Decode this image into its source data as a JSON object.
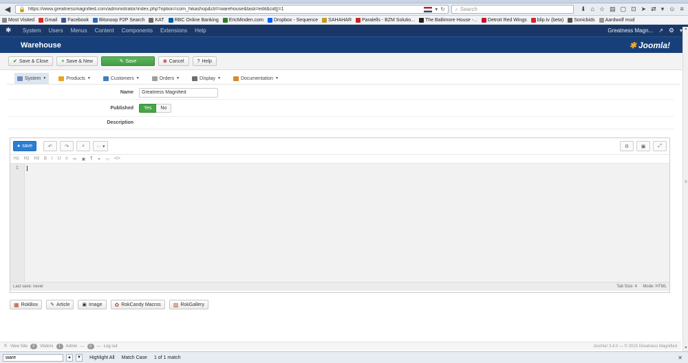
{
  "browser": {
    "url": "https://www.greatnessmagnified.com/administrator/index.php?option=com_hikashop&ctrl=warehouse&task=edit&cid[]=1",
    "search_placeholder": "Search",
    "bookmarks": [
      {
        "label": "Most Visited",
        "color": "#888888"
      },
      {
        "label": "Gmail",
        "color": "#d93025"
      },
      {
        "label": "Facebook",
        "color": "#3b5998"
      },
      {
        "label": "Bitsnoop P2P Search",
        "color": "#2b6cb0"
      },
      {
        "label": "KAT",
        "color": "#6b6b6b"
      },
      {
        "label": "RBC Online Banking",
        "color": "#005daa"
      },
      {
        "label": "EricMinden.com",
        "color": "#2d7d2d"
      },
      {
        "label": "Dropbox - Sequence",
        "color": "#0061fe"
      },
      {
        "label": "SAHAHAR",
        "color": "#c59b1a"
      },
      {
        "label": "Paralells - BZM Solutio...",
        "color": "#cc2222"
      },
      {
        "label": "The Baltimore House -...",
        "color": "#222222"
      },
      {
        "label": "Detroit Red Wings",
        "color": "#c8102e"
      },
      {
        "label": "blip.tv (beta)",
        "color": "#d9232d"
      },
      {
        "label": "Sonicbids",
        "color": "#555555"
      },
      {
        "label": "Aardwolf mud",
        "color": "#999999"
      }
    ]
  },
  "admin_bar": {
    "menu": [
      "System",
      "Users",
      "Menus",
      "Content",
      "Components",
      "Extensions",
      "Help"
    ],
    "site_name": "Greatness Magn...",
    "external_icon": "↗",
    "user_icon": "⚙"
  },
  "header": {
    "title": "Warehouse",
    "logo_text": "Joomla!"
  },
  "toolbar": {
    "save_close": "Save & Close",
    "save_new": "Save & New",
    "save": "Save",
    "cancel": "Cancel",
    "help": "Help"
  },
  "submenu": [
    {
      "label": "System",
      "color": "#6b8cbf",
      "active": true
    },
    {
      "label": "Products",
      "color": "#e8a321",
      "active": false
    },
    {
      "label": "Customers",
      "color": "#3f7fbf",
      "active": false
    },
    {
      "label": "Orders",
      "color": "#a0a0a0",
      "active": false
    },
    {
      "label": "Display",
      "color": "#6d6d6d",
      "active": false
    },
    {
      "label": "Documentation",
      "color": "#d98b2b",
      "active": false
    }
  ],
  "form": {
    "name_label": "Name",
    "name_value": "Greatness Magnified",
    "published_label": "Published",
    "yes": "Yes",
    "no": "No",
    "description_label": "Description"
  },
  "editor": {
    "save_label": "save",
    "format_buttons": [
      "H1",
      "H2",
      "H3",
      "B",
      "I",
      "U",
      "≡",
      "≔",
      "▣",
      "¶",
      "⚭",
      "▭",
      "</>"
    ],
    "line_number": "1",
    "last_save": "Last save: never",
    "tab_size": "Tab Size: 4",
    "mode": "Mode: HTML"
  },
  "plugins": [
    "RokBox",
    "Article",
    "Image",
    "RokCandy Macros",
    "RokGallery"
  ],
  "footer": {
    "view_site": "View Site",
    "visitors_count": "0",
    "visitors_label": "Visitors",
    "admin_count": "1",
    "admin_label": "Admin",
    "messages_count": "0",
    "logout": "Log out",
    "copyright": "Joomla! 3.4.0 — © 2015 Greatness Magnified"
  },
  "findbar": {
    "query": "ware",
    "highlight_all": "Highlight All",
    "match_case": "Match Case",
    "result": "1 of 1 match"
  }
}
